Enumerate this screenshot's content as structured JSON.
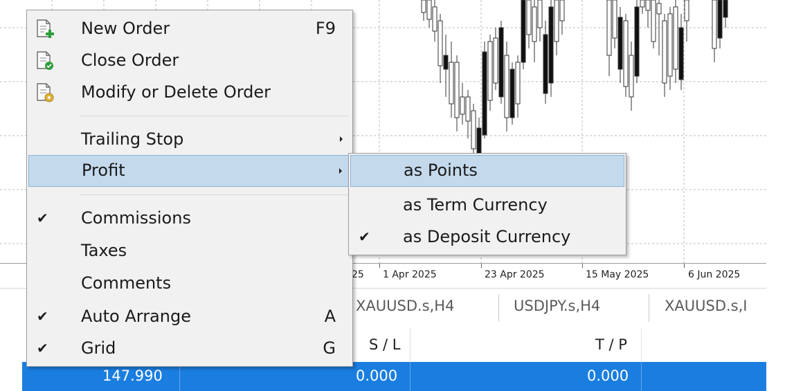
{
  "context_menu": {
    "items": [
      {
        "label": "New Order",
        "shortcut": "F9",
        "icon": "new-order-icon"
      },
      {
        "label": "Close Order",
        "icon": "close-order-icon"
      },
      {
        "label": "Modify or Delete Order",
        "icon": "modify-order-icon"
      },
      {
        "label": "Trailing Stop"
      },
      {
        "label": "Profit"
      },
      {
        "label": "Commissions",
        "checked": true
      },
      {
        "label": "Taxes"
      },
      {
        "label": "Comments"
      },
      {
        "label": "Auto Arrange",
        "shortcut": "A",
        "checked": true
      },
      {
        "label": "Grid",
        "shortcut": "G",
        "checked": true
      }
    ],
    "checkmark": "✔"
  },
  "profit_submenu": {
    "items": [
      {
        "label": "as Points"
      },
      {
        "label": "as Term Currency"
      },
      {
        "label": "as Deposit Currency",
        "checked": true
      }
    ]
  },
  "chart": {
    "date_labels": [
      "25",
      "1 Apr 2025",
      "23 Apr 2025",
      "15 May 2025",
      "6 Jun 2025"
    ]
  },
  "chart_tabs": [
    "XAUUSD.s,H4",
    "USDJPY.s,H4",
    "XAUUSD.s,I"
  ],
  "table": {
    "headers": {
      "sl": "S / L",
      "tp": "T / P"
    },
    "selected_row": {
      "price": "147.990",
      "sl": "0.000",
      "tp": "0.000"
    },
    "selected_color": "#1a7ee0"
  }
}
